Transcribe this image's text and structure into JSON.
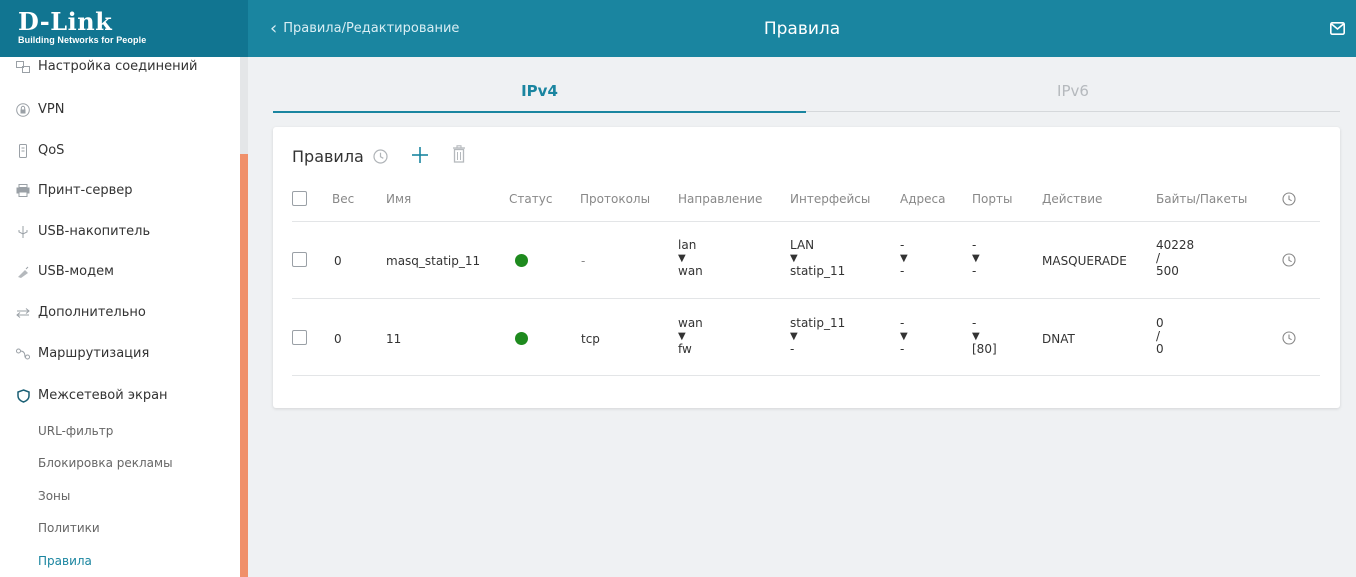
{
  "header": {
    "logo_main": "D-Link",
    "logo_sub": "Building Networks for People",
    "back_label": "Правила/Редактирование",
    "title": "Правила",
    "bg_color": "#1a85a0"
  },
  "sidebar": {
    "items": [
      {
        "label": "Настройка соединений",
        "icon": "connections-icon"
      },
      {
        "label": "VPN",
        "icon": "vpn-lock-icon"
      },
      {
        "label": "QoS",
        "icon": "qos-icon"
      },
      {
        "label": "Принт-сервер",
        "icon": "printer-icon"
      },
      {
        "label": "USB-накопитель",
        "icon": "usb-icon"
      },
      {
        "label": "USB-модем",
        "icon": "modem-icon"
      },
      {
        "label": "Дополнительно",
        "icon": "arrows-icon"
      },
      {
        "label": "Маршрутизация",
        "icon": "routing-icon"
      },
      {
        "label": "Межсетевой экран",
        "icon": "shield-icon"
      }
    ],
    "subitems": [
      {
        "label": "URL-фильтр"
      },
      {
        "label": "Блокировка рекламы"
      },
      {
        "label": "Зоны"
      },
      {
        "label": "Политики"
      },
      {
        "label": "Правила",
        "active": true
      }
    ]
  },
  "tabs": [
    {
      "label": "IPv4",
      "active": true
    },
    {
      "label": "IPv6",
      "active": false
    }
  ],
  "rules": {
    "title": "Правила",
    "columns": [
      "Вес",
      "Имя",
      "Статус",
      "Протоколы",
      "Направление",
      "Интерфейсы",
      "Адреса",
      "Порты",
      "Действие",
      "Байты/Пакеты"
    ],
    "status_color": "#1e8a1e",
    "rows": [
      {
        "weight": "0",
        "name": "masq_statip_11",
        "protocol": "-",
        "direction_from": "lan",
        "direction_to": "wan",
        "iface_from": "LAN",
        "iface_to": "statip_11",
        "addr_from": "-",
        "addr_to": "-",
        "port_from": "-",
        "port_to": "-",
        "action": "MASQUERADE",
        "bytes": "40228",
        "sep": "/",
        "packets": "500"
      },
      {
        "weight": "0",
        "name": "11",
        "protocol": "tcp",
        "direction_from": "wan",
        "direction_to": "fw",
        "iface_from": "statip_11",
        "iface_to": "-",
        "addr_from": "-",
        "addr_to": "-",
        "port_from": "-",
        "port_to": "[80]",
        "action": "DNAT",
        "bytes": "0",
        "sep": "/",
        "packets": "0"
      }
    ],
    "arrow": "▼"
  }
}
